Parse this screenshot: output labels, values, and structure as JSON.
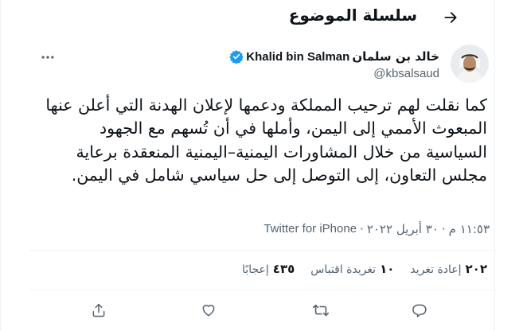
{
  "header": {
    "title": "سلسلة الموضوع"
  },
  "author": {
    "name_ar": "خالد بن سلمان",
    "name_en": "Khalid bin Salman",
    "handle": "@kbsalsaud"
  },
  "tweet": {
    "text": "كما نقلت لهم ترحيب المملكة ودعمها لإعلان الهدنة التي أعلن عنها المبعوث الأممي إلى اليمن، وأملها في أن تُسهم مع الجهود السياسية من خلال المشاورات اليمنية–اليمنية المنعقدة برعاية مجلس التعاون، إلى التوصل إلى حل سياسي شامل في اليمن.",
    "time": "١١:٥٣ م",
    "date": "٣٠ أبريل ٢٠٢٢",
    "source": "Twitter for iPhone",
    "separator": "·"
  },
  "stats": [
    {
      "count": "٢٠٢",
      "label": "إعادة تغريد"
    },
    {
      "count": "١٠",
      "label": "تغريدة اقتباس"
    },
    {
      "count": "٤٣٥",
      "label": "إعجابًا"
    }
  ],
  "icons": {
    "back": "arrow-right-icon",
    "more": "more-horizontal-icon",
    "verified": "verified-badge-icon",
    "reply": "reply-icon",
    "retweet": "retweet-icon",
    "like": "heart-icon",
    "share": "share-icon"
  },
  "colors": {
    "text": "#0f1419",
    "muted": "#536471",
    "verified": "#1d9bf0",
    "divider": "#eff3f4"
  }
}
